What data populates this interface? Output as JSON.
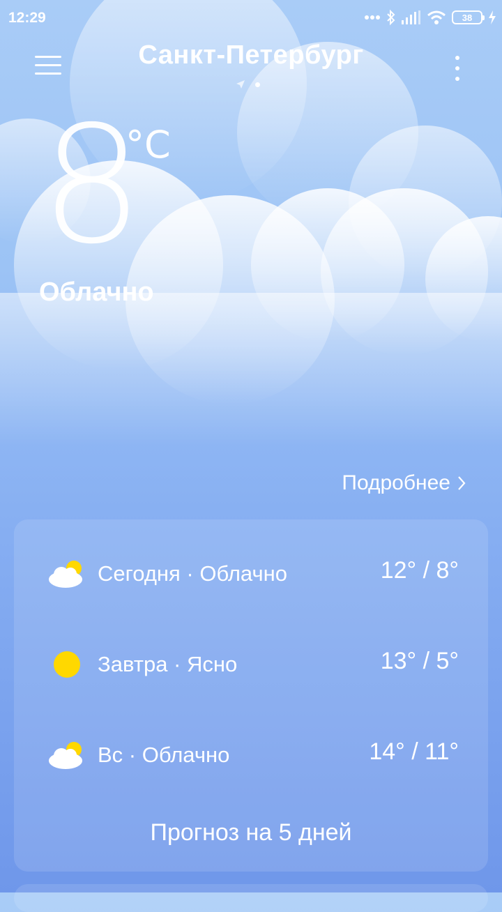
{
  "status_bar": {
    "time": "12:29",
    "battery_level": "38",
    "icons": [
      "more-dots-icon",
      "bluetooth-icon",
      "signal-icon",
      "wifi-icon",
      "battery-icon",
      "charging-icon"
    ]
  },
  "header": {
    "city": "Санкт-Петербург",
    "icons": [
      "menu-icon",
      "location-arrow-icon",
      "more-vertical-icon"
    ]
  },
  "current": {
    "temperature": "8",
    "unit": "°C",
    "condition": "Облачно"
  },
  "details_link": "Подробнее",
  "forecast": [
    {
      "label": "Сегодня · Облачно",
      "temps": "12° / 8°",
      "icon": "partly-cloudy-icon"
    },
    {
      "label": "Завтра · Ясно",
      "temps": "13° / 5°",
      "icon": "sun-icon"
    },
    {
      "label": "Вс · Облачно",
      "temps": "14° / 11°",
      "icon": "partly-cloudy-icon"
    }
  ],
  "forecast_5day": "Прогноз на 5 дней",
  "colors": {
    "background_top": "#a9ccf7",
    "background_bottom": "#6f97ea",
    "sun": "#ffd800"
  }
}
